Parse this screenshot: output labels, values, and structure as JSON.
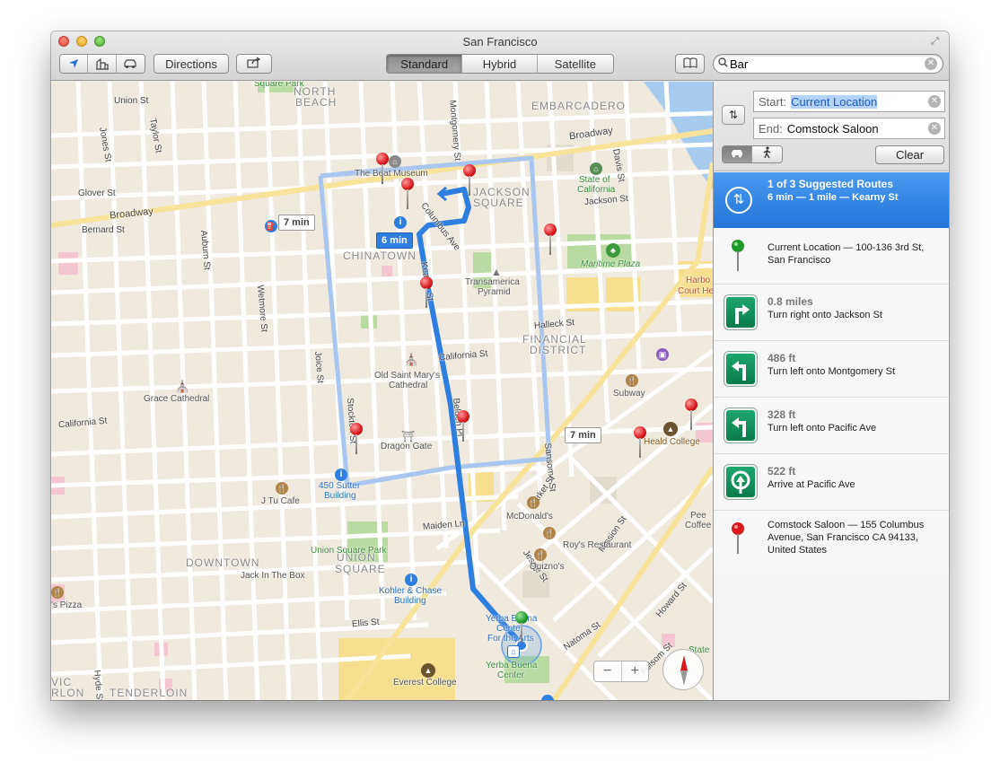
{
  "window": {
    "title": "San Francisco"
  },
  "toolbar": {
    "location_icon": "location-arrow-icon",
    "three_d_icon": "3d-buildings-icon",
    "traffic_icon": "car-icon",
    "directions_label": "Directions",
    "share_icon": "share-icon",
    "map_modes": [
      "Standard",
      "Hybrid",
      "Satellite"
    ],
    "active_mode": "Standard",
    "bookmarks_icon": "book-icon",
    "search": {
      "value": "Bar",
      "placeholder": ""
    }
  },
  "directions": {
    "start_label": "Start:",
    "start_value": "Current Location",
    "end_label": "End:",
    "end_value": "Comstock Saloon",
    "clear_label": "Clear",
    "summary": {
      "title": "1 of 3 Suggested Routes",
      "detail": "6 min — 1 mile — Kearny St"
    },
    "steps": [
      {
        "type": "start",
        "distance": "",
        "text": "Current Location — 100-136 3rd St, San Francisco"
      },
      {
        "type": "turn-right",
        "distance": "0.8 miles",
        "text": "Turn right onto Jackson St"
      },
      {
        "type": "turn-left",
        "distance": "486 ft",
        "text": "Turn left onto Montgomery St"
      },
      {
        "type": "turn-left",
        "distance": "328 ft",
        "text": "Turn left onto Pacific Ave"
      },
      {
        "type": "arrive",
        "distance": "522 ft",
        "text": "Arrive at Pacific Ave"
      },
      {
        "type": "end",
        "distance": "",
        "text": "Comstock Saloon — 155 Columbus Avenue, San Francisco CA 94133, United States"
      }
    ]
  },
  "map": {
    "route_callouts": {
      "primary": "6 min",
      "alt_left": "7 min",
      "alt_right": "7 min"
    },
    "areas": {
      "north_beach_1": "NORTH",
      "north_beach_2": "BEACH",
      "embarcadero": "EMBARCADERO",
      "jackson_square_1": "JACKSON",
      "jackson_square_2": "SQUARE",
      "chinatown": "CHINATOWN",
      "financial_1": "FINANCIAL",
      "financial_2": "DISTRICT",
      "downtown": "DOWNTOWN",
      "union_square_1": "UNION",
      "union_square_2": "SQUARE",
      "tenderloin": "TENDERLOIN",
      "civic_1": "VIC",
      "civic_2": "RLON"
    },
    "streets": {
      "union": "Union St",
      "broadway_left": "Broadway",
      "broadway_right": "Broadway",
      "glover": "Glover St",
      "bernard": "Bernard St",
      "california_left": "California St",
      "california_mid": "California St",
      "jones": "Jones St",
      "taylor": "Taylor St",
      "auburn": "Auburn St",
      "wetmore": "Wetmore St",
      "joice": "Joice St",
      "stockton": "Stockton St",
      "kearny": "Kearny St",
      "montgomery": "Montgomery St",
      "davis": "Davis St",
      "jackson": "Jackson St",
      "columbus": "Columbus Ave",
      "halleck": "Halleck St",
      "sansome": "Sansome St",
      "market": "Market St",
      "mission": "Mission St",
      "howard": "Howard St",
      "natoma": "Natoma St",
      "maiden": "Maiden Ln",
      "ellis": "Ellis St",
      "folsom": "Folsom St",
      "hyde": "Hyde St",
      "belden": "Belden Pl",
      "jessie": "Jessie St"
    },
    "pois": {
      "beat_museum": "The Beat Museum",
      "state_calif_1": "State of",
      "state_calif_2": "California",
      "maritime_plaza": "Maritime Plaza",
      "transamerica_1": "Transamerica",
      "transamerica_2": "Pyramid",
      "harbor_court_1": "Harbo",
      "harbor_court_2": "Court He",
      "old_st_marys_1": "Old Saint Mary's",
      "old_st_marys_2": "Cathedral",
      "grace_cathedral": "Grace Cathedral",
      "subway": "Subway",
      "heald_college": "Heald College",
      "dragon_gate": "Dragon Gate",
      "sutter_1": "450 Sutter",
      "sutter_2": "Building",
      "j_tu_cafe": "J Tu Cafe",
      "mcdonalds": "McDonald's",
      "roys": "Roy's Restaurant",
      "quiznos": "Quizno's",
      "union_square_park": "Union Square Park",
      "jack_in_the_box": "Jack In The Box",
      "kohler_1": "Kohler & Chase",
      "kohler_2": "Building",
      "ybca_1": "Yerba Buena",
      "ybca_2": "Center",
      "ybca_3": "For the Arts",
      "yb_center_1": "Yerba Buena",
      "yb_center_2": "Center",
      "everest": "Everest College",
      "pizza": "'s Pizza",
      "peet_1": "Pee",
      "peet_2": "Coffee",
      "state_right": "State",
      "square_park_top": "Square Park"
    }
  },
  "colors": {
    "route_primary": "#2f7fe0",
    "route_alt": "#a9c6ee",
    "park": "#b9dba1",
    "water": "#a6cbee",
    "land": "#efe9de"
  }
}
